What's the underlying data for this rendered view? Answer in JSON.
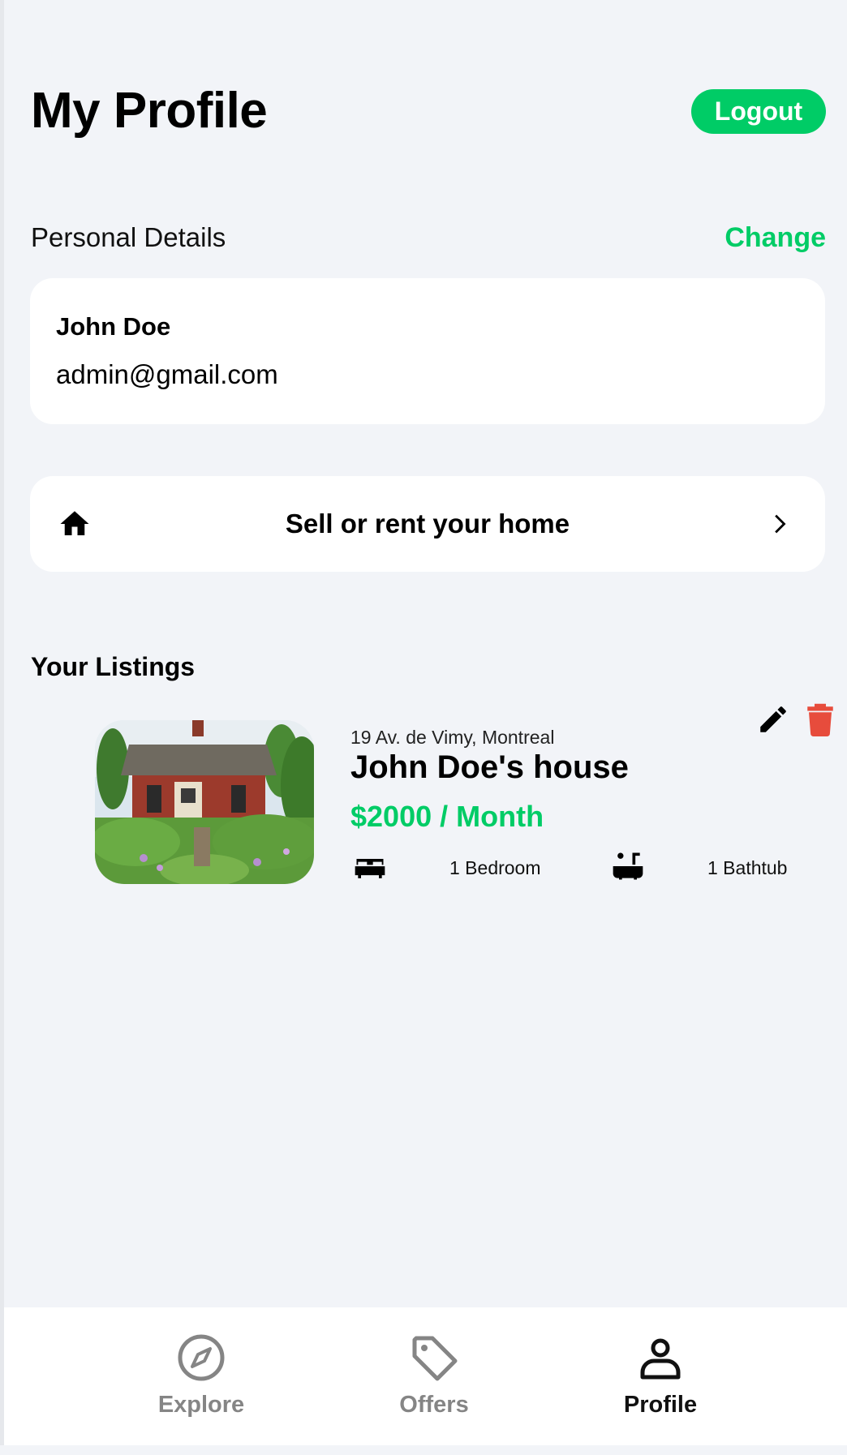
{
  "header": {
    "title": "My Profile",
    "logout_label": "Logout"
  },
  "personal": {
    "section_label": "Personal Details",
    "change_label": "Change",
    "name": "John Doe",
    "email": "admin@gmail.com"
  },
  "sell": {
    "label": "Sell or rent your home",
    "icon": "home-icon",
    "chevron": "chevron-right-icon"
  },
  "listings": {
    "title": "Your Listings",
    "items": [
      {
        "address": "19 Av. de Vimy, Montreal",
        "name": "John Doe's house",
        "price": "$2000 / Month",
        "bedrooms": "1 Bedroom",
        "bathrooms": "1 Bathtub"
      }
    ]
  },
  "tabs": [
    {
      "label": "Explore",
      "icon": "compass-icon",
      "active": false
    },
    {
      "label": "Offers",
      "icon": "tag-icon",
      "active": false
    },
    {
      "label": "Profile",
      "icon": "person-icon",
      "active": true
    }
  ],
  "colors": {
    "accent": "#00cc66",
    "danger": "#e74c3c",
    "background": "#f2f4f8",
    "inactive": "#858585"
  }
}
